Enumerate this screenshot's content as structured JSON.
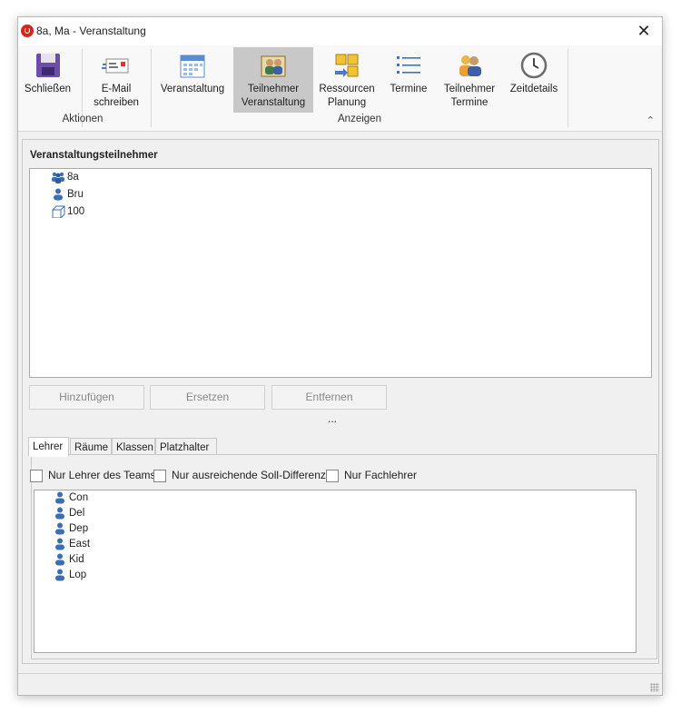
{
  "window": {
    "title": "8a, Ma - Veranstaltung",
    "close_label": "✕"
  },
  "ribbon": {
    "groups": [
      {
        "label": "Aktionen"
      },
      {
        "label": "Anzeigen"
      }
    ],
    "buttons": [
      {
        "label": "Schließen"
      },
      {
        "label": "E-Mail\nschreiben"
      },
      {
        "label": "Veranstaltung"
      },
      {
        "label": "Teilnehmer\nVeranstaltung",
        "active": true
      },
      {
        "label": "Ressourcen\nPlanung"
      },
      {
        "label": "Termine"
      },
      {
        "label": "Teilnehmer\nTermine"
      },
      {
        "label": "Zeitdetails"
      }
    ],
    "collapse_label": "⌃"
  },
  "participants": {
    "title": "Veranstaltungsteilnehmer",
    "items": [
      {
        "label": "8a",
        "icon": "group-icon"
      },
      {
        "label": "Bru",
        "icon": "teacher-icon"
      },
      {
        "label": "100",
        "icon": "room-icon"
      }
    ]
  },
  "actions": {
    "add": "Hinzufügen",
    "replace": "Ersetzen",
    "remove": "Entfernen",
    "more": "..."
  },
  "tabs": [
    "Lehrer",
    "Räume",
    "Klassen",
    "Platzhalter"
  ],
  "filters": [
    {
      "label": "Nur Lehrer des Teams",
      "checked": false
    },
    {
      "label": "Nur ausreichende Soll-Differenz",
      "checked": false
    },
    {
      "label": "Nur Fachlehrer",
      "checked": false
    }
  ],
  "teachers": [
    "Con",
    "Del",
    "Dep",
    "East",
    "Kid",
    "Lop"
  ],
  "colors": {
    "accent_selected": "#c8c8c8",
    "app_icon": "#d9241c",
    "person_icon": "#3a6fb6"
  }
}
